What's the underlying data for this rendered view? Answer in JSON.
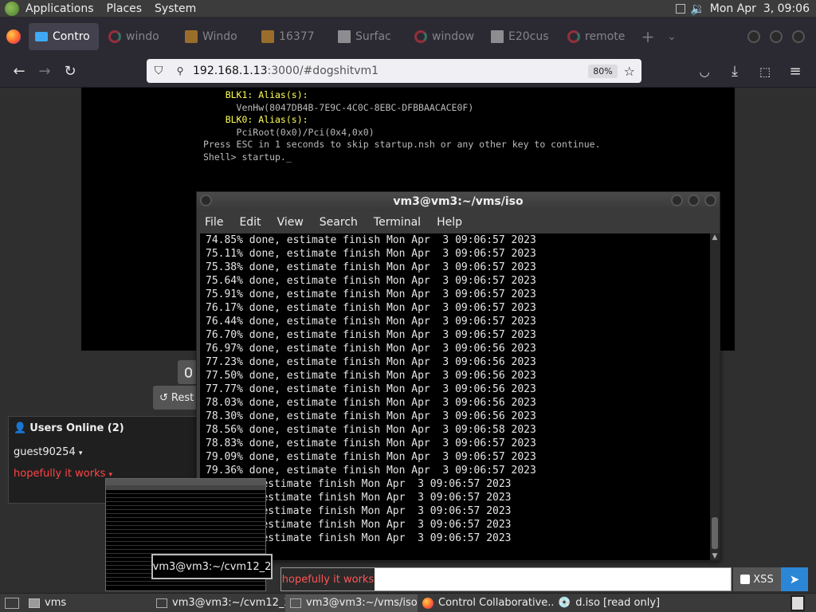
{
  "topbar": {
    "menus": [
      "Applications",
      "Places",
      "System"
    ],
    "datetime": "Mon Apr  3, 09:06"
  },
  "tabs": [
    {
      "label": "Contro",
      "favicon": "monitor-icon",
      "active": true
    },
    {
      "label": "windo",
      "favicon": "google-icon"
    },
    {
      "label": "Windo",
      "favicon": "bn-icon"
    },
    {
      "label": "16377",
      "favicon": "bn-icon"
    },
    {
      "label": "Surfac",
      "favicon": "library-icon"
    },
    {
      "label": "window",
      "favicon": "google-icon"
    },
    {
      "label": "E20cus",
      "favicon": "library-icon"
    },
    {
      "label": "remote",
      "favicon": "google-icon"
    }
  ],
  "url": {
    "host": "192.168.1.13",
    "rest": ":3000/#dogshitvm1",
    "zoom": "80%"
  },
  "vm_screen": {
    "lines": [
      {
        "t": "    BLK1: Alias(s):",
        "hl": true
      },
      {
        "t": "      VenHw(8047DB4B-7E9C-4C0C-8EBC-DFBBAACACE0F)",
        "hl": false
      },
      {
        "t": "    BLK0: Alias(s):",
        "hl": true
      },
      {
        "t": "      PciRoot(0x0)/Pci(0x4,0x0)",
        "hl": false
      },
      {
        "t": "Press ESC in 1 seconds to skip startup.nsh or any other key to continue.",
        "hl": false
      },
      {
        "t": "Shell> startup._",
        "hl": false
      }
    ]
  },
  "buttons": {
    "restart": "Rest"
  },
  "users_panel": {
    "title": "Users Online (2)",
    "users": [
      {
        "name": "guest90254",
        "color": "#ffffff"
      },
      {
        "name": "hopefully it works",
        "color": "#ff4444"
      }
    ]
  },
  "terminal": {
    "title": "vm3@vm3:~/vms/iso",
    "menu": [
      "File",
      "Edit",
      "View",
      "Search",
      "Terminal",
      "Help"
    ],
    "lines": [
      "74.85% done, estimate finish Mon Apr  3 09:06:57 2023",
      "75.11% done, estimate finish Mon Apr  3 09:06:57 2023",
      "75.38% done, estimate finish Mon Apr  3 09:06:57 2023",
      "75.64% done, estimate finish Mon Apr  3 09:06:57 2023",
      "75.91% done, estimate finish Mon Apr  3 09:06:57 2023",
      "76.17% done, estimate finish Mon Apr  3 09:06:57 2023",
      "76.44% done, estimate finish Mon Apr  3 09:06:57 2023",
      "76.70% done, estimate finish Mon Apr  3 09:06:57 2023",
      "76.97% done, estimate finish Mon Apr  3 09:06:56 2023",
      "77.23% done, estimate finish Mon Apr  3 09:06:56 2023",
      "77.50% done, estimate finish Mon Apr  3 09:06:56 2023",
      "77.77% done, estimate finish Mon Apr  3 09:06:56 2023",
      "78.03% done, estimate finish Mon Apr  3 09:06:56 2023",
      "78.30% done, estimate finish Mon Apr  3 09:06:56 2023",
      "78.56% done, estimate finish Mon Apr  3 09:06:58 2023",
      "78.83% done, estimate finish Mon Apr  3 09:06:57 2023",
      "79.09% done, estimate finish Mon Apr  3 09:06:57 2023",
      "79.36% done, estimate finish Mon Apr  3 09:06:57 2023",
      "      e, estimate finish Mon Apr  3 09:06:57 2023",
      "      e, estimate finish Mon Apr  3 09:06:57 2023",
      "      e, estimate finish Mon Apr  3 09:06:57 2023",
      "      e, estimate finish Mon Apr  3 09:06:57 2023",
      "      e, estimate finish Mon Apr  3 09:06:57 2023"
    ]
  },
  "tooltip": "vm3@vm3:~/cvm12_2",
  "chat": {
    "input_value": "hopefully it works",
    "xss_label": "XSS"
  },
  "taskbar": {
    "items": [
      {
        "label": "vms",
        "active": false
      },
      {
        "label": "vm3@vm3:~/cvm12_2",
        "active": false
      },
      {
        "label": "vm3@vm3:~/vms/iso",
        "active": true
      },
      {
        "label": "Control Collaborative...",
        "active": false
      },
      {
        "label": "d.iso [read only]",
        "active": false
      }
    ]
  }
}
